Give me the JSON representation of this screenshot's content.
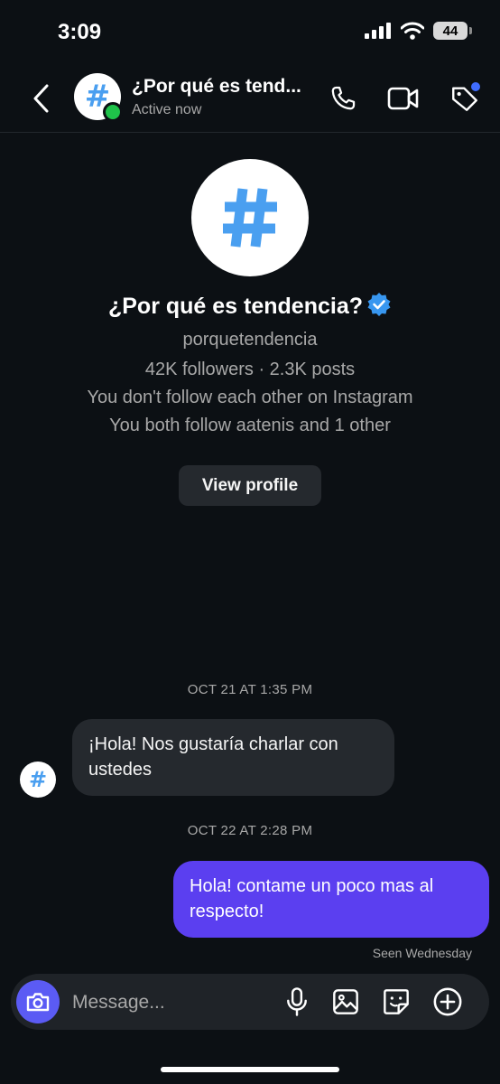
{
  "status_bar": {
    "time": "3:09",
    "battery": "44"
  },
  "header": {
    "title": "¿Por qué es tend...",
    "subtitle": "Active now",
    "avatar_glyph": "#"
  },
  "profile": {
    "avatar_glyph": "#",
    "name": "¿Por qué es tendencia?",
    "username": "porquetendencia",
    "stats": "42K followers · 2.3K posts",
    "follow_status": "You don't follow each other on Instagram",
    "mutuals": "You both follow aatenis and 1 other",
    "view_profile_label": "View profile"
  },
  "messages": [
    {
      "timestamp": "OCT 21 AT 1:35 PM",
      "sender": "them",
      "text": "¡Hola! Nos gustaría charlar con ustedes",
      "avatar_glyph": "#"
    },
    {
      "timestamp": "OCT 22 AT 2:28 PM",
      "sender": "me",
      "text": "Hola! contame un poco mas al respecto!"
    }
  ],
  "seen_status": "Seen Wednesday",
  "composer": {
    "placeholder": "Message..."
  },
  "icons": {
    "back": "chevron-left-icon",
    "call": "phone-icon",
    "video": "video-camera-icon",
    "tag": "tag-icon",
    "camera": "camera-icon",
    "mic": "microphone-icon",
    "gallery": "image-icon",
    "sticker": "sticker-icon",
    "add": "plus-circle-icon"
  },
  "colors": {
    "background": "#0c1014",
    "bubble_incoming": "#25292e",
    "bubble_outgoing": "#5b3ff0",
    "online": "#1fc34a",
    "accent_hashtag": "#4a9ff0",
    "verified": "#3897f0"
  }
}
